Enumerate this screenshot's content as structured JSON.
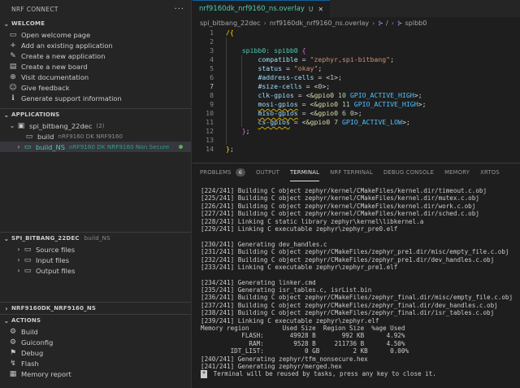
{
  "sidebar": {
    "title": "NRF CONNECT",
    "more": "···",
    "welcome": {
      "header": "WELCOME",
      "items": [
        {
          "icon": "folder-open-icon",
          "glyph": "▭",
          "label": "Open welcome page"
        },
        {
          "icon": "add-folder-icon",
          "glyph": "+",
          "label": "Add an existing application"
        },
        {
          "icon": "new-app-icon",
          "glyph": "✎",
          "label": "Create a new application"
        },
        {
          "icon": "board-icon",
          "glyph": "▤",
          "label": "Create a new board"
        },
        {
          "icon": "globe-icon",
          "glyph": "⊕",
          "label": "Visit documentation"
        },
        {
          "icon": "feedback-icon",
          "glyph": "☺",
          "label": "Give feedback"
        },
        {
          "icon": "support-icon",
          "glyph": "ℹ",
          "label": "Generate support information"
        }
      ]
    },
    "applications": {
      "header": "APPLICATIONS",
      "app_name": "spi_bitbang_22dec",
      "app_count": "(2)",
      "builds": [
        {
          "name": "build",
          "board": "nRF9160 DK NRF9160"
        },
        {
          "name": "build_NS",
          "board": "nRF9160 DK NRF9160 Non Secure"
        }
      ]
    },
    "app_section": {
      "header": "SPI_BITBANG_22DEC",
      "sub": "build_NS",
      "items": [
        "Source files",
        "Input files",
        "Output files"
      ]
    },
    "board_section": {
      "header": "NRF9160DK_NRF9160_NS"
    },
    "actions": {
      "header": "ACTIONS",
      "items": [
        {
          "icon": "build-icon",
          "glyph": "⚙",
          "label": "Build"
        },
        {
          "icon": "guiconfig-icon",
          "glyph": "⚙",
          "label": "Guiconfig"
        },
        {
          "icon": "debug-icon",
          "glyph": "⚑",
          "label": "Debug"
        },
        {
          "icon": "flash-icon",
          "glyph": "↯",
          "label": "Flash"
        },
        {
          "icon": "memory-report-icon",
          "glyph": "▦",
          "label": "Memory report"
        }
      ]
    }
  },
  "editor": {
    "tab_label": "nrf9160dk_nrf9160_ns.overlay",
    "tab_status": "U",
    "breadcrumbs": [
      "spi_bitbang_22dec",
      "nrf9160dk_nrf9160_ns.overlay",
      "/",
      "spibb0"
    ],
    "current_line": "7",
    "lines": [
      {
        "n": "1",
        "parts": [
          [
            "k-brace",
            "/{"
          ]
        ]
      },
      {
        "n": "2",
        "parts": []
      },
      {
        "n": "3",
        "parts": [
          [
            "",
            "    "
          ],
          [
            "k-node",
            "spibb0: spibb0 "
          ],
          [
            "k-brace2",
            "{"
          ]
        ]
      },
      {
        "n": "4",
        "parts": [
          [
            "",
            "        "
          ],
          [
            "k-prop",
            "compatible"
          ],
          [
            "",
            " = "
          ],
          [
            "k-str",
            "\"zephyr,spi-bitbang\""
          ],
          [
            "",
            ";"
          ]
        ]
      },
      {
        "n": "5",
        "parts": [
          [
            "",
            "        "
          ],
          [
            "k-prop",
            "status"
          ],
          [
            "",
            " = "
          ],
          [
            "k-str",
            "\"okay\""
          ],
          [
            "",
            ";"
          ]
        ]
      },
      {
        "n": "6",
        "parts": [
          [
            "",
            "        "
          ],
          [
            "k-prop",
            "#address-cells"
          ],
          [
            "",
            " = <"
          ],
          [
            "k-num",
            "1"
          ],
          [
            "",
            ">;"
          ]
        ]
      },
      {
        "n": "7",
        "parts": [
          [
            "",
            "        "
          ],
          [
            "k-prop",
            "#size-cells"
          ],
          [
            "",
            " = <"
          ],
          [
            "k-num",
            "0"
          ],
          [
            "",
            ">;"
          ]
        ]
      },
      {
        "n": "8",
        "parts": [
          [
            "",
            "        "
          ],
          [
            "k-prop",
            "clk-gpios"
          ],
          [
            "",
            " = <"
          ],
          [
            "k-ref",
            "&gpio0"
          ],
          [
            "",
            " "
          ],
          [
            "k-num",
            "10"
          ],
          [
            "",
            " "
          ],
          [
            "k-macro",
            "GPIO_ACTIVE_HIGH"
          ],
          [
            "",
            ">;"
          ]
        ]
      },
      {
        "n": "9",
        "parts": [
          [
            "",
            "        "
          ],
          [
            "k-prop squig",
            "mosi-gpios"
          ],
          [
            "",
            " = <"
          ],
          [
            "k-ref",
            "&gpio0"
          ],
          [
            "",
            " "
          ],
          [
            "k-num",
            "11"
          ],
          [
            "",
            " "
          ],
          [
            "k-macro",
            "GPIO_ACTIVE_HIGH"
          ],
          [
            "",
            ">;"
          ]
        ]
      },
      {
        "n": "10",
        "parts": [
          [
            "",
            "        "
          ],
          [
            "k-prop squig",
            "miso-gpios"
          ],
          [
            "",
            " = <"
          ],
          [
            "k-ref",
            "&gpio0"
          ],
          [
            "",
            " "
          ],
          [
            "k-num",
            "6"
          ],
          [
            "",
            " "
          ],
          [
            "k-num",
            "0"
          ],
          [
            "",
            ">;"
          ]
        ]
      },
      {
        "n": "11",
        "parts": [
          [
            "",
            "        "
          ],
          [
            "k-prop squig",
            "cs-gpios"
          ],
          [
            "",
            " = <"
          ],
          [
            "k-ref",
            "&gpio0"
          ],
          [
            "",
            " "
          ],
          [
            "k-num",
            "7"
          ],
          [
            "",
            " "
          ],
          [
            "k-macro",
            "GPIO_ACTIVE_LOW"
          ],
          [
            "",
            ">;"
          ]
        ]
      },
      {
        "n": "12",
        "parts": [
          [
            "",
            "    "
          ],
          [
            "k-brace2",
            "}"
          ],
          [
            "",
            ";"
          ]
        ]
      },
      {
        "n": "13",
        "parts": []
      },
      {
        "n": "14",
        "parts": [
          [
            "k-brace",
            "}"
          ],
          [
            "",
            ";"
          ]
        ]
      }
    ]
  },
  "panel": {
    "tabs": [
      {
        "label": "PROBLEMS",
        "badge": "6",
        "active": false
      },
      {
        "label": "OUTPUT",
        "active": false
      },
      {
        "label": "TERMINAL",
        "active": true
      },
      {
        "label": "NRF TERMINAL",
        "active": false
      },
      {
        "label": "DEBUG CONSOLE",
        "active": false
      },
      {
        "label": "MEMORY",
        "active": false
      },
      {
        "label": "XRTOS",
        "active": false
      }
    ],
    "terminal_lines": [
      "[224/241] Building C object zephyr/kernel/CMakeFiles/kernel.dir/timeout.c.obj",
      "[225/241] Building C object zephyr/kernel/CMakeFiles/kernel.dir/mutex.c.obj",
      "[226/241] Building C object zephyr/kernel/CMakeFiles/kernel.dir/work.c.obj",
      "[227/241] Building C object zephyr/kernel/CMakeFiles/kernel.dir/sched.c.obj",
      "[228/241] Linking C static library zephyr\\kernel\\libkernel.a",
      "[229/241] Linking C executable zephyr\\zephyr_pre0.elf",
      "",
      "[230/241] Generating dev_handles.c",
      "[231/241] Building C object zephyr/CMakeFiles/zephyr_pre1.dir/misc/empty_file.c.obj",
      "[232/241] Building C object zephyr/CMakeFiles/zephyr_pre1.dir/dev_handles.c.obj",
      "[233/241] Linking C executable zephyr\\zephyr_pre1.elf",
      "",
      "[234/241] Generating linker.cmd",
      "[235/241] Generating isr_tables.c, isrList.bin",
      "[236/241] Building C object zephyr/CMakeFiles/zephyr_final.dir/misc/empty_file.c.obj",
      "[237/241] Building C object zephyr/CMakeFiles/zephyr_final.dir/dev_handles.c.obj",
      "[238/241] Building C object zephyr/CMakeFiles/zephyr_final.dir/isr_tables.c.obj",
      "[239/241] Linking C executable zephyr\\zephyr.elf",
      "Memory region         Used Size  Region Size  %age Used",
      "           FLASH:       49928 B       992 KB      4.92%",
      "             RAM:        9528 B     211736 B      4.50%",
      "        IDT_LIST:           0 GB         2 KB      0.00%",
      "[240/241] Generating zephyr/tfm_nonsecure.hex",
      "[241/241] Generating zephyr/merged.hex"
    ],
    "terminal_footer": " Terminal will be reused by tasks, press any key to close it."
  }
}
